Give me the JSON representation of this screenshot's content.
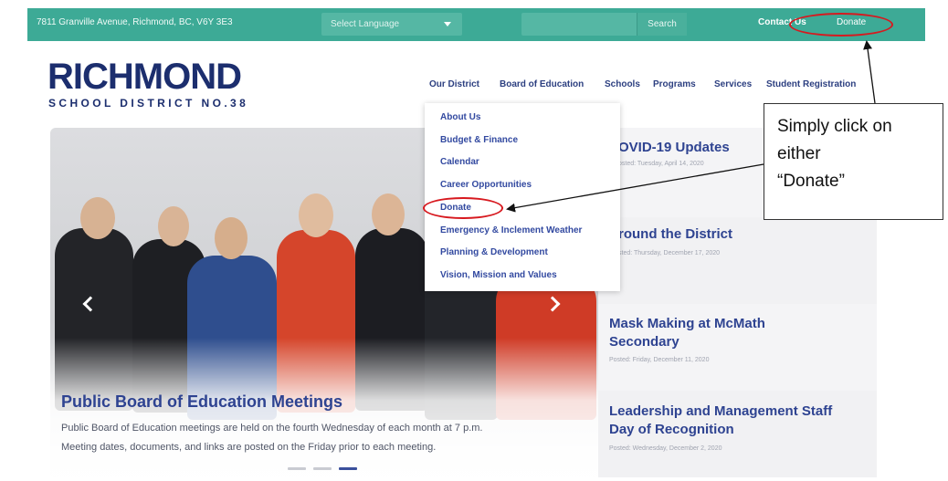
{
  "topbar": {
    "address": "7811 Granville Avenue, Richmond, BC, V6Y 3E3",
    "language_placeholder": "Select Language",
    "search_label": "Search",
    "contact_label": "Contact Us",
    "donate_label": "Donate"
  },
  "logo": {
    "title": "RICHMOND",
    "subtitle": "SCHOOL DISTRICT NO.38"
  },
  "nav": {
    "items": [
      "Our District",
      "Board of Education",
      "Schools",
      "Programs",
      "Services",
      "Student Registration"
    ]
  },
  "dropdown": {
    "items": [
      "About Us",
      "Budget & Finance",
      "Calendar",
      "Career Opportunities",
      "Donate",
      "Emergency & Inclement Weather",
      "Planning & Development",
      "Vision, Mission and Values"
    ]
  },
  "hero": {
    "title": "Public Board of Education Meetings",
    "line1": "Public Board of Education meetings are held on the fourth Wednesday of each month at 7 p.m.",
    "line2": "Meeting dates, documents, and links are posted on the Friday prior to each meeting."
  },
  "news": [
    {
      "title": "OVID-19 Updates",
      "date": "osted: Tuesday, April 14, 2020"
    },
    {
      "title": "round the District",
      "date": "sted: Thursday, December 17, 2020"
    },
    {
      "title_line1": "Mask Making at McMath",
      "title_line2": "Secondary",
      "date": "Posted: Friday, December 11, 2020"
    },
    {
      "title_line1": "Leadership and Management Staff",
      "title_line2": "Day of Recognition",
      "date": "Posted: Wednesday, December 2, 2020"
    }
  ],
  "callout": {
    "line1": "Simply click on",
    "line2": "either",
    "line3": "“Donate”"
  },
  "colors": {
    "teal": "#3daa96",
    "navy": "#1c2e6e",
    "link_blue": "#2e4391",
    "highlight_red": "#d7191f"
  }
}
